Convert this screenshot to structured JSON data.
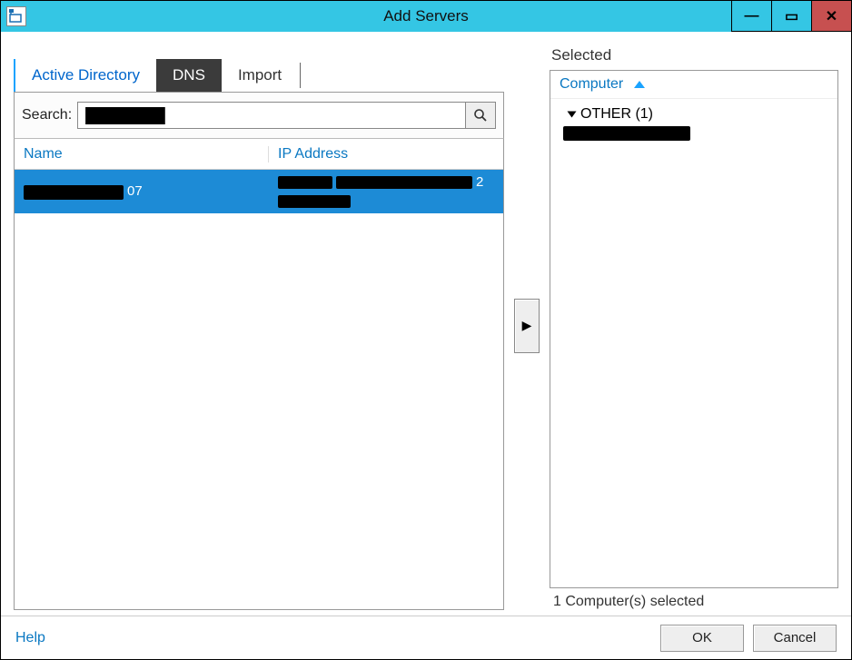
{
  "window": {
    "title": "Add Servers"
  },
  "tabs": {
    "active_directory": "Active Directory",
    "dns": "DNS",
    "import": "Import"
  },
  "search": {
    "label": "Search:",
    "value": "██████████"
  },
  "grid": {
    "col_name": "Name",
    "col_ip": "IP Address",
    "rows": [
      {
        "name_suffix": "07",
        "ip_suffix": "2"
      }
    ]
  },
  "selected_panel": {
    "title": "Selected",
    "column": "Computer",
    "group_label": "OTHER (1)",
    "status": "1 Computer(s) selected"
  },
  "footer": {
    "help": "Help",
    "ok": "OK",
    "cancel": "Cancel"
  }
}
